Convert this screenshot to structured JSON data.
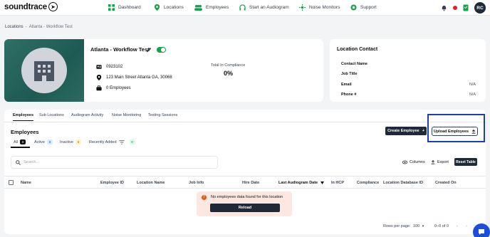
{
  "brand": {
    "name": "soundtrace"
  },
  "nav": {
    "items": [
      {
        "label": "Dashboard",
        "icon": "dashboard-icon"
      },
      {
        "label": "Locations",
        "icon": "location-pin-icon"
      },
      {
        "label": "Employees",
        "icon": "people-icon"
      },
      {
        "label": "Start an Audiogram",
        "icon": "headphones-icon"
      },
      {
        "label": "Noise Monitors",
        "icon": "noise-monitor-icon"
      },
      {
        "label": "Support",
        "icon": "support-icon"
      }
    ],
    "avatar": "RC"
  },
  "breadcrumb": {
    "parent": "Locations",
    "separator": "-",
    "current": "Atlanta - Workflow Test"
  },
  "location": {
    "name": "Atlanta - Workflow Test",
    "active": true,
    "phone": "0923102",
    "address": "123 Main Street Atlanta GA, 30068",
    "employees": "0 Employees",
    "compliance_label": "Total In Compliance",
    "compliance_value": "0%"
  },
  "contact": {
    "title": "Location Contact",
    "rows": [
      {
        "label": "Contact Name",
        "value": ""
      },
      {
        "label": "Job Title",
        "value": ""
      },
      {
        "label": "Email",
        "value": "N/A"
      },
      {
        "label": "Phone #",
        "value": "N/A"
      }
    ]
  },
  "tabs": [
    "Employees",
    "Sub Locations",
    "Audiogram Activity",
    "Noise Monitoring",
    "Testing Sessions"
  ],
  "employees": {
    "title": "Employees",
    "create_label": "Create Employee",
    "upload_label": "Upload Employees",
    "filters": [
      {
        "label": "All",
        "count": "0"
      },
      {
        "label": "Active",
        "count": "0"
      },
      {
        "label": "Inactive",
        "count": "0"
      },
      {
        "label": "Recently Added",
        "count": "0"
      }
    ],
    "search_placeholder": "Search...",
    "columns_label": "Columns",
    "export_label": "Export",
    "reset_label": "Reset Table",
    "headers": [
      "Name",
      "Employee ID",
      "Location Name",
      "Job Info",
      "Hire Date",
      "Last Audiogram Date",
      "In HCP",
      "Compliance",
      "Location Database ID",
      "Created On"
    ],
    "empty_message": "No employees data found for this location",
    "reload_label": "Reload",
    "rows_per_page_label": "Rows per page:",
    "rows_per_page": "100",
    "range": "0–0 of 0"
  },
  "colors": {
    "accent": "#1f2937",
    "toggle": "#16a34a",
    "highlight": "#1e40af"
  }
}
